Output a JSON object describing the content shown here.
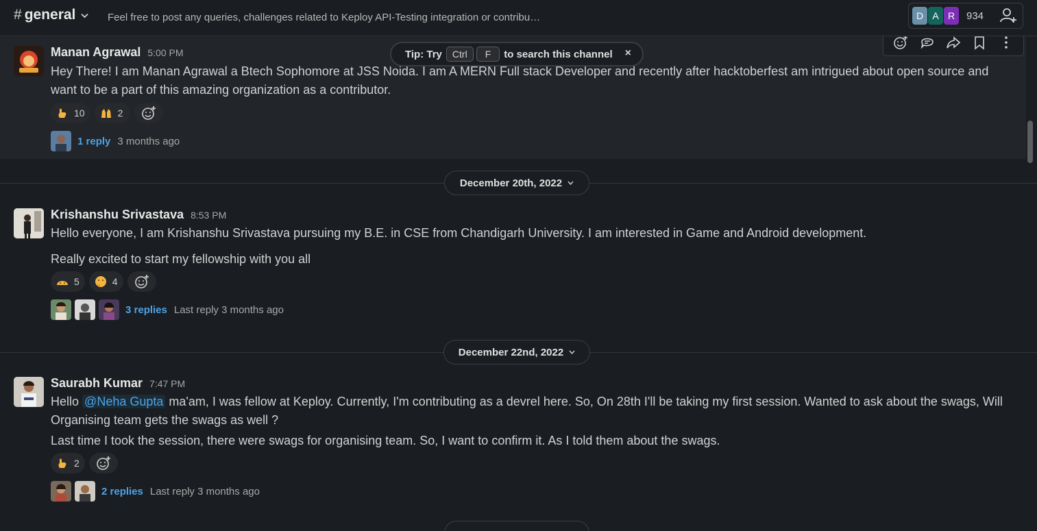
{
  "header": {
    "hash": "#",
    "channel_name": "general",
    "topic": "Feel free to post any queries, challenges related to Keploy API-Testing integration or contribu…",
    "member_initials": [
      "D",
      "A",
      "R"
    ],
    "member_colors": [
      "#6a8fa8",
      "#13645a",
      "#7b2fb5"
    ],
    "member_count": "934"
  },
  "tip": {
    "prefix": "Tip: Try",
    "key1": "Ctrl",
    "key2": "F",
    "suffix": "to search this channel",
    "close": "×"
  },
  "messages": [
    {
      "author": "Manan Agrawal",
      "time": "5:00 PM",
      "text": "Hey There! I am Manan Agrawal a Btech Sophomore at JSS Noida. I am A MERN Full stack Developer and recently after hacktoberfest am intrigued about open source and want to be a part of this amazing organization as a contributor.",
      "reactions": [
        {
          "emoji": "hand-point-icon",
          "count": "10"
        },
        {
          "emoji": "raised-hands-icon",
          "count": "2"
        }
      ],
      "replies": "1 reply",
      "last_reply": "3 months ago"
    },
    {
      "author": "Krishanshu Srivastava",
      "time": "8:53 PM",
      "text_line1": "Hello everyone, I am Krishanshu Srivastava pursuing my B.E. in CSE from Chandigarh University. I am interested in Game and Android development.",
      "text_line2": "Really excited to start my fellowship with you all",
      "reactions": [
        {
          "emoji": "wave-face-icon",
          "count": "5"
        },
        {
          "emoji": "thinking-face-icon",
          "count": "4"
        }
      ],
      "replies": "3 replies",
      "last_reply": "Last reply 3 months ago"
    },
    {
      "author": "Saurabh Kumar",
      "time": "7:47 PM",
      "text_pre": "Hello",
      "mention": "@Neha Gupta",
      "text_post": " ma'am, I was fellow at Keploy. Currently, I'm contributing as a devrel here. So, On 28th I'll be taking my first session. Wanted to ask about the swags, Will Organising team gets the swags as well ?",
      "text_line2": "Last time I took the session, there were swags for organising team. So, I want to confirm it. As I told them about the swags.",
      "reactions": [
        {
          "emoji": "hand-point-icon",
          "count": "2"
        }
      ],
      "replies": "2 replies",
      "last_reply": "Last reply 3 months ago"
    }
  ],
  "dates": [
    "December 20th, 2022",
    "December 22nd, 2022"
  ]
}
